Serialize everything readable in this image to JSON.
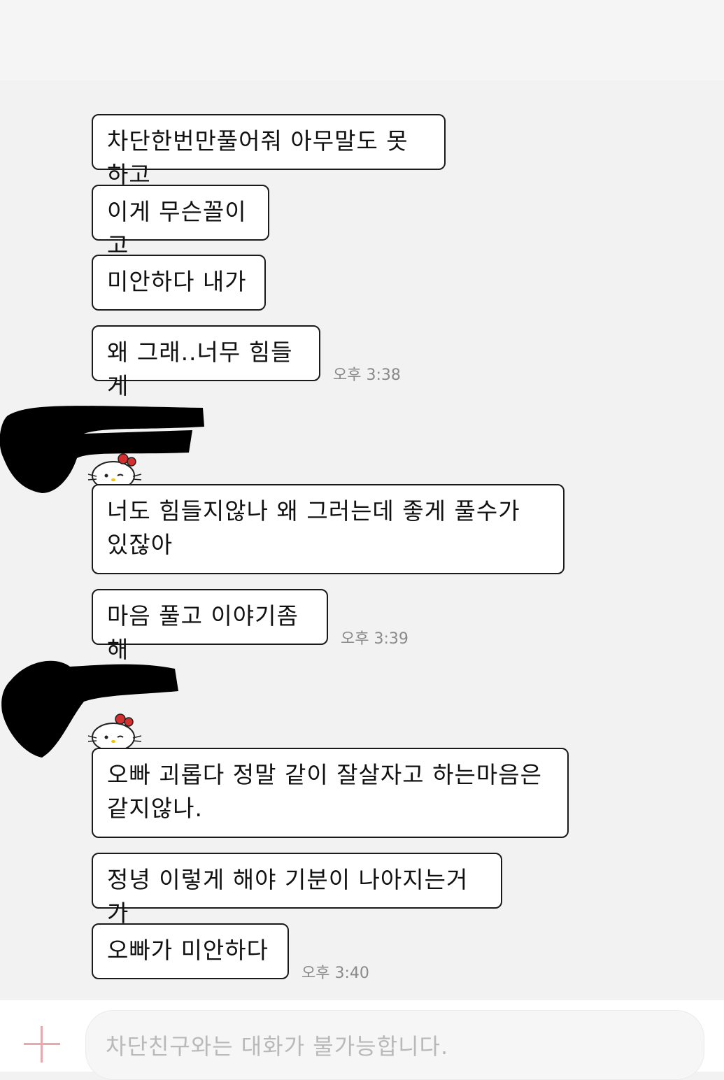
{
  "messages": {
    "m1": "차단한번만풀어줘 아무말도 못하고",
    "m2": "이게 무슨꼴이고",
    "m3": "미안하다 내가",
    "m4": "왜 그래..너무 힘들게",
    "m5": "너도 힘들지않나 왜 그러는데 좋게 풀수가 있잖아",
    "m6": "마음 풀고 이야기좀 해",
    "m7": "오빠 괴롭다 정말 같이 잘살자고 하는마음은 같지않나.",
    "m8": "정녕 이렇게 해야 기분이 나아지는거가",
    "m9": "오빠가 미안하다"
  },
  "timestamps": {
    "t1": "오후 3:38",
    "t2": "오후 3:39",
    "t3": "오후 3:40"
  },
  "input": {
    "placeholder": "차단친구와는 대화가 불가능합니다."
  },
  "icons": {
    "attach": "plus-icon",
    "avatar": "hello-kitty-avatar",
    "accent": "#e7a9ad"
  }
}
